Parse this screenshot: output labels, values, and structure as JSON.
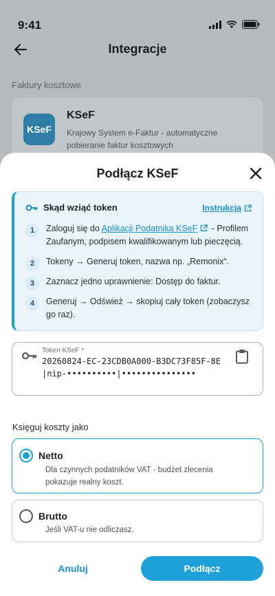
{
  "status": {
    "time": "9:41"
  },
  "background": {
    "title": "Integracje",
    "section": "Faktury kosztowe",
    "card": {
      "logo_text": "KSeF",
      "title": "KSeF",
      "description": "Krajowy System e-Faktur - automatyczne pobieranie faktur kosztowych"
    }
  },
  "sheet": {
    "title": "Podłącz KSeF",
    "info": {
      "title": "Skąd wziąć token",
      "link_label": "Instrukcja",
      "steps": [
        {
          "num": "1",
          "before": "Zaloguj się do ",
          "link": "Aplikacji Podatnika KSeF",
          "after": " - Profilem Zaufanym, podpisem kwalifikowanym lub pieczęcią."
        },
        {
          "num": "2",
          "text": "Tokeny → Generuj token, nazwa np. „Remonix“."
        },
        {
          "num": "3",
          "text": "Zaznacz jedno uprawnienie: Dostęp do faktur."
        },
        {
          "num": "4",
          "text": "Generuj → Odśwież → skopiuj cały token (zobaczysz go raz)."
        }
      ]
    },
    "token": {
      "label": "Token KSeF *",
      "value": "20260824-EC-23CDB0A000-B3DC73F85F-8E|nip-••••••••••|•••••••••••••••"
    },
    "cost_label": "Księguj koszty jako",
    "options": [
      {
        "title": "Netto",
        "description": "Dla czynnych podatników VAT - budżet zlecenia pokazuje realny koszt.",
        "selected": true
      },
      {
        "title": "Brutto",
        "description": "Jeśli VAT-u nie odliczasz.",
        "selected": false
      }
    ],
    "cancel_label": "Anuluj",
    "connect_label": "Podłącz"
  },
  "colors": {
    "accent": "#1da1d8",
    "link": "#1b8fc7",
    "info_bg": "#eaf4fb"
  },
  "icons": [
    "back-arrow-icon",
    "close-icon",
    "key-icon",
    "external-link-icon",
    "clipboard-icon",
    "signal-icon",
    "wifi-icon",
    "battery-icon"
  ]
}
